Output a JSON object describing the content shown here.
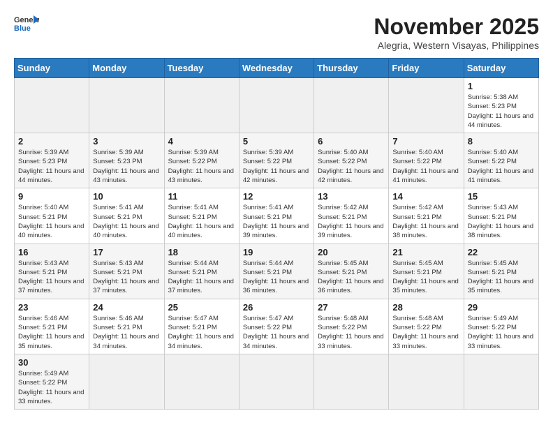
{
  "header": {
    "logo_general": "General",
    "logo_blue": "Blue",
    "month_title": "November 2025",
    "subtitle": "Alegria, Western Visayas, Philippines"
  },
  "weekdays": [
    "Sunday",
    "Monday",
    "Tuesday",
    "Wednesday",
    "Thursday",
    "Friday",
    "Saturday"
  ],
  "weeks": [
    [
      {
        "day": "",
        "info": ""
      },
      {
        "day": "",
        "info": ""
      },
      {
        "day": "",
        "info": ""
      },
      {
        "day": "",
        "info": ""
      },
      {
        "day": "",
        "info": ""
      },
      {
        "day": "",
        "info": ""
      },
      {
        "day": "1",
        "info": "Sunrise: 5:38 AM\nSunset: 5:23 PM\nDaylight: 11 hours\nand 44 minutes."
      }
    ],
    [
      {
        "day": "2",
        "info": "Sunrise: 5:39 AM\nSunset: 5:23 PM\nDaylight: 11 hours\nand 44 minutes."
      },
      {
        "day": "3",
        "info": "Sunrise: 5:39 AM\nSunset: 5:23 PM\nDaylight: 11 hours\nand 43 minutes."
      },
      {
        "day": "4",
        "info": "Sunrise: 5:39 AM\nSunset: 5:22 PM\nDaylight: 11 hours\nand 43 minutes."
      },
      {
        "day": "5",
        "info": "Sunrise: 5:39 AM\nSunset: 5:22 PM\nDaylight: 11 hours\nand 42 minutes."
      },
      {
        "day": "6",
        "info": "Sunrise: 5:40 AM\nSunset: 5:22 PM\nDaylight: 11 hours\nand 42 minutes."
      },
      {
        "day": "7",
        "info": "Sunrise: 5:40 AM\nSunset: 5:22 PM\nDaylight: 11 hours\nand 41 minutes."
      },
      {
        "day": "8",
        "info": "Sunrise: 5:40 AM\nSunset: 5:22 PM\nDaylight: 11 hours\nand 41 minutes."
      }
    ],
    [
      {
        "day": "9",
        "info": "Sunrise: 5:40 AM\nSunset: 5:21 PM\nDaylight: 11 hours\nand 40 minutes."
      },
      {
        "day": "10",
        "info": "Sunrise: 5:41 AM\nSunset: 5:21 PM\nDaylight: 11 hours\nand 40 minutes."
      },
      {
        "day": "11",
        "info": "Sunrise: 5:41 AM\nSunset: 5:21 PM\nDaylight: 11 hours\nand 40 minutes."
      },
      {
        "day": "12",
        "info": "Sunrise: 5:41 AM\nSunset: 5:21 PM\nDaylight: 11 hours\nand 39 minutes."
      },
      {
        "day": "13",
        "info": "Sunrise: 5:42 AM\nSunset: 5:21 PM\nDaylight: 11 hours\nand 39 minutes."
      },
      {
        "day": "14",
        "info": "Sunrise: 5:42 AM\nSunset: 5:21 PM\nDaylight: 11 hours\nand 38 minutes."
      },
      {
        "day": "15",
        "info": "Sunrise: 5:43 AM\nSunset: 5:21 PM\nDaylight: 11 hours\nand 38 minutes."
      }
    ],
    [
      {
        "day": "16",
        "info": "Sunrise: 5:43 AM\nSunset: 5:21 PM\nDaylight: 11 hours\nand 37 minutes."
      },
      {
        "day": "17",
        "info": "Sunrise: 5:43 AM\nSunset: 5:21 PM\nDaylight: 11 hours\nand 37 minutes."
      },
      {
        "day": "18",
        "info": "Sunrise: 5:44 AM\nSunset: 5:21 PM\nDaylight: 11 hours\nand 37 minutes."
      },
      {
        "day": "19",
        "info": "Sunrise: 5:44 AM\nSunset: 5:21 PM\nDaylight: 11 hours\nand 36 minutes."
      },
      {
        "day": "20",
        "info": "Sunrise: 5:45 AM\nSunset: 5:21 PM\nDaylight: 11 hours\nand 36 minutes."
      },
      {
        "day": "21",
        "info": "Sunrise: 5:45 AM\nSunset: 5:21 PM\nDaylight: 11 hours\nand 35 minutes."
      },
      {
        "day": "22",
        "info": "Sunrise: 5:45 AM\nSunset: 5:21 PM\nDaylight: 11 hours\nand 35 minutes."
      }
    ],
    [
      {
        "day": "23",
        "info": "Sunrise: 5:46 AM\nSunset: 5:21 PM\nDaylight: 11 hours\nand 35 minutes."
      },
      {
        "day": "24",
        "info": "Sunrise: 5:46 AM\nSunset: 5:21 PM\nDaylight: 11 hours\nand 34 minutes."
      },
      {
        "day": "25",
        "info": "Sunrise: 5:47 AM\nSunset: 5:21 PM\nDaylight: 11 hours\nand 34 minutes."
      },
      {
        "day": "26",
        "info": "Sunrise: 5:47 AM\nSunset: 5:22 PM\nDaylight: 11 hours\nand 34 minutes."
      },
      {
        "day": "27",
        "info": "Sunrise: 5:48 AM\nSunset: 5:22 PM\nDaylight: 11 hours\nand 33 minutes."
      },
      {
        "day": "28",
        "info": "Sunrise: 5:48 AM\nSunset: 5:22 PM\nDaylight: 11 hours\nand 33 minutes."
      },
      {
        "day": "29",
        "info": "Sunrise: 5:49 AM\nSunset: 5:22 PM\nDaylight: 11 hours\nand 33 minutes."
      }
    ],
    [
      {
        "day": "30",
        "info": "Sunrise: 5:49 AM\nSunset: 5:22 PM\nDaylight: 11 hours\nand 33 minutes."
      },
      {
        "day": "",
        "info": ""
      },
      {
        "day": "",
        "info": ""
      },
      {
        "day": "",
        "info": ""
      },
      {
        "day": "",
        "info": ""
      },
      {
        "day": "",
        "info": ""
      },
      {
        "day": "",
        "info": ""
      }
    ]
  ]
}
